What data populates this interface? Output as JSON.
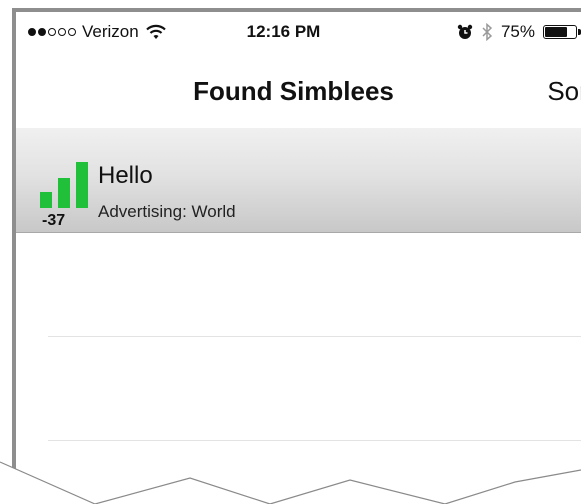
{
  "status_bar": {
    "carrier": "Verizon",
    "time": "12:16 PM",
    "battery": "75%",
    "battery_level": 0.75,
    "signal_dots_filled": 2,
    "signal_dots_total": 5,
    "icons": [
      "wifi-icon",
      "alarm-icon",
      "bluetooth-icon",
      "battery-icon"
    ]
  },
  "nav": {
    "title": "Found Simblees",
    "sort_label": "Sort"
  },
  "devices": [
    {
      "name": "Hello",
      "advertising": "Advertising: World",
      "rssi": "-37",
      "signal_color": "#21c03a",
      "signal_bars": 3
    }
  ]
}
